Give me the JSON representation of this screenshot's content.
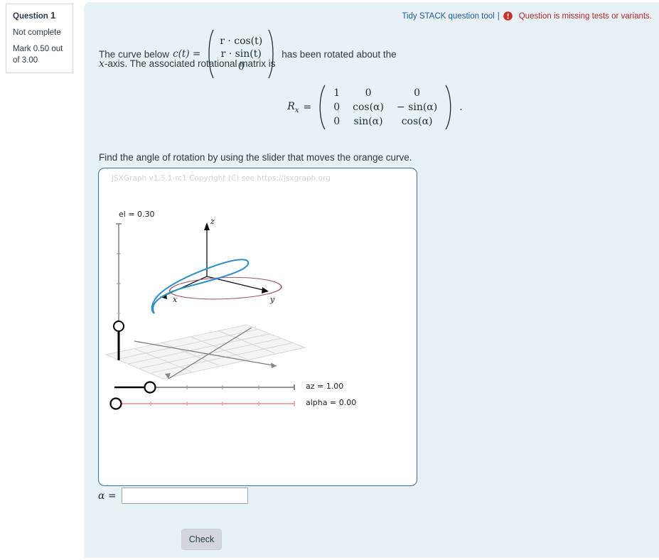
{
  "question_info": {
    "label": "Question",
    "number": "1",
    "state": "Not complete",
    "mark": "Mark 0.50 out of 3.00"
  },
  "stack_header": {
    "tool_label": "Tidy STACK question tool",
    "separator": "|",
    "warning_icon": "exclamation-circle-icon",
    "warning_message": "Question is missing tests or variants.",
    "link_color": "#1b5b9e",
    "warning_color": "#b02a2a"
  },
  "statement": {
    "line1_prefix": "The curve below",
    "curve_name": "c(t) =",
    "vector": [
      "r · cos(t)",
      "r · sin(t)",
      "0"
    ],
    "line1_suffix": "has been rotated about the",
    "line2": "-axis. The associated rotational matrix is",
    "line2_axis": "x",
    "matrix_name": "R",
    "matrix_subscript": "x",
    "matrix_equals": "=",
    "matrix_rows": [
      [
        "1",
        "0",
        "0"
      ],
      [
        "0",
        "cos(α)",
        "− sin(α)"
      ],
      [
        "0",
        "sin(α)",
        "cos(α)"
      ]
    ],
    "matrix_period": ".",
    "find_instruction": "Find the angle of rotation by using the slider that moves the orange curve."
  },
  "board": {
    "credit": "JSXGraph v1.5.1-rc1 Copyright (C) see https://jsxgraph.org",
    "credit_color": "#d3d3d3",
    "border_color": "#3b6ea5",
    "axis_labels": {
      "x": "x",
      "y": "y",
      "z": "z"
    },
    "curve_colors": {
      "original": "#a0566a",
      "rotated": "#2c8fc9"
    },
    "sliders": [
      {
        "name": "el-slider",
        "label": "el = 0.30",
        "value": 0.3,
        "orientation": "vertical",
        "handle_fraction": 0.86,
        "color": "#555555"
      },
      {
        "name": "az-slider",
        "label": "az = 1.00",
        "value": 1.0,
        "orientation": "horizontal",
        "handle_fraction": 0.2,
        "color": "#333333"
      },
      {
        "name": "alpha-slider",
        "label": "alpha = 0.00",
        "value": 0.0,
        "orientation": "horizontal",
        "handle_fraction": 0.0,
        "color": "#e78b8b"
      }
    ]
  },
  "answer": {
    "label": "α =",
    "value": "",
    "placeholder": ""
  },
  "actions": {
    "check_label": "Check"
  },
  "colors": {
    "panel_background": "#e8f1f5",
    "page_background": "#ffffff",
    "button_background": "#d3d7dd"
  }
}
